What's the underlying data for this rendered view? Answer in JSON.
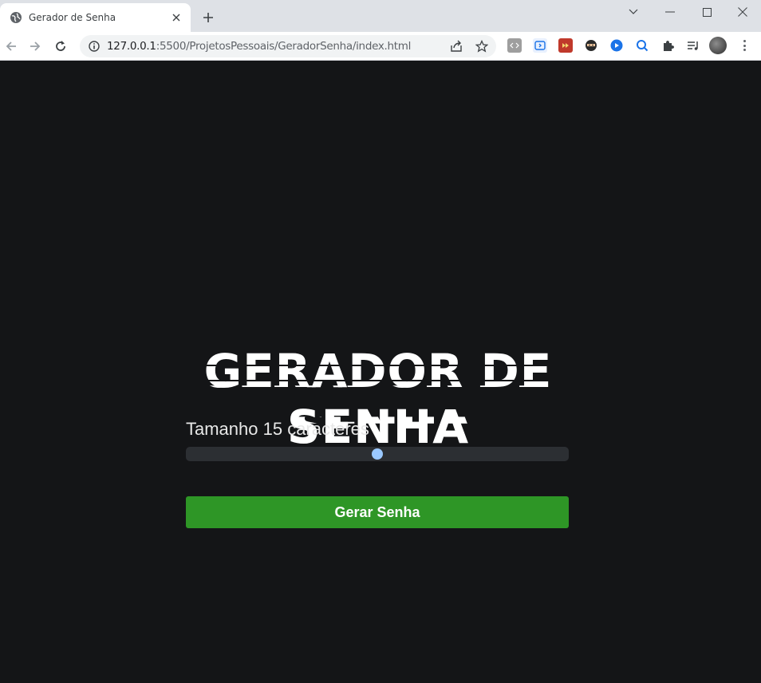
{
  "browser": {
    "tab_title": "Gerador de Senha",
    "url_host": "127.0.0.1",
    "url_rest": ":5500/ProjetosPessoais/GeradorSenha/index.html"
  },
  "page": {
    "heading": "GERADOR DE SENHA",
    "length_label": "Tamanho 15 caracteres",
    "slider": {
      "value": 15,
      "fraction": 0.5
    },
    "generate_button": "Gerar Senha"
  },
  "colors": {
    "background": "#141517",
    "button": "#2e9626",
    "slider_thumb": "#9ac8ff",
    "slider_track": "#2c2f33"
  },
  "icons": {
    "tab_favicon": "globe-icon",
    "tab_close": "close-icon",
    "new_tab": "plus-icon",
    "back": "arrow-left-icon",
    "forward": "arrow-right-icon",
    "reload": "reload-icon",
    "site_info": "info-icon",
    "share": "share-icon",
    "bookmark": "star-icon",
    "extensions": "puzzle-icon",
    "media": "media-control-icon",
    "menu": "kebab-menu-icon"
  }
}
